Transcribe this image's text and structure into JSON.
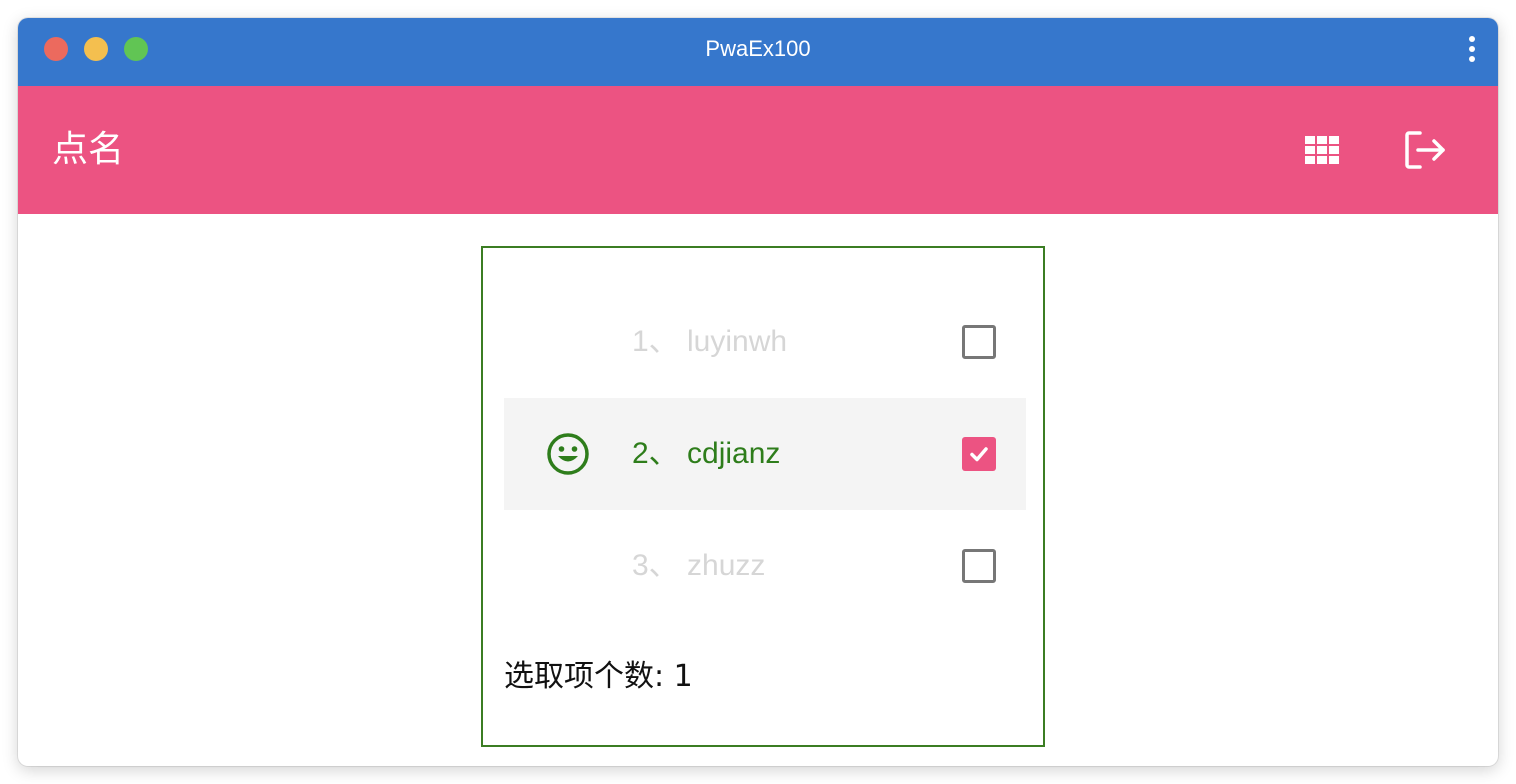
{
  "window": {
    "title": "PwaEx100",
    "menu_icon": "more-vertical-icon"
  },
  "appbar": {
    "title": "点名",
    "background": "#ec5382",
    "actions": [
      {
        "icon": "grid-icon"
      },
      {
        "icon": "logout-icon"
      }
    ]
  },
  "list": {
    "items": [
      {
        "index": "1、",
        "name": "luyinwh",
        "label": "1、 luyinwh",
        "checked": false
      },
      {
        "index": "2、",
        "name": "cdjianz",
        "label": "2、 cdjianz",
        "checked": true,
        "icon": "smile-icon"
      },
      {
        "index": "3、",
        "name": "zhuzz",
        "label": "3、 zhuzz",
        "checked": false
      }
    ],
    "selected_count_text": "选取项个数: 1",
    "selected_color": "#2e7d1b",
    "unselected_color": "#d6d6d6"
  },
  "colors": {
    "titlebar": "#3677cc",
    "accent": "#ec5382",
    "panel_border": "#3b7d23"
  }
}
